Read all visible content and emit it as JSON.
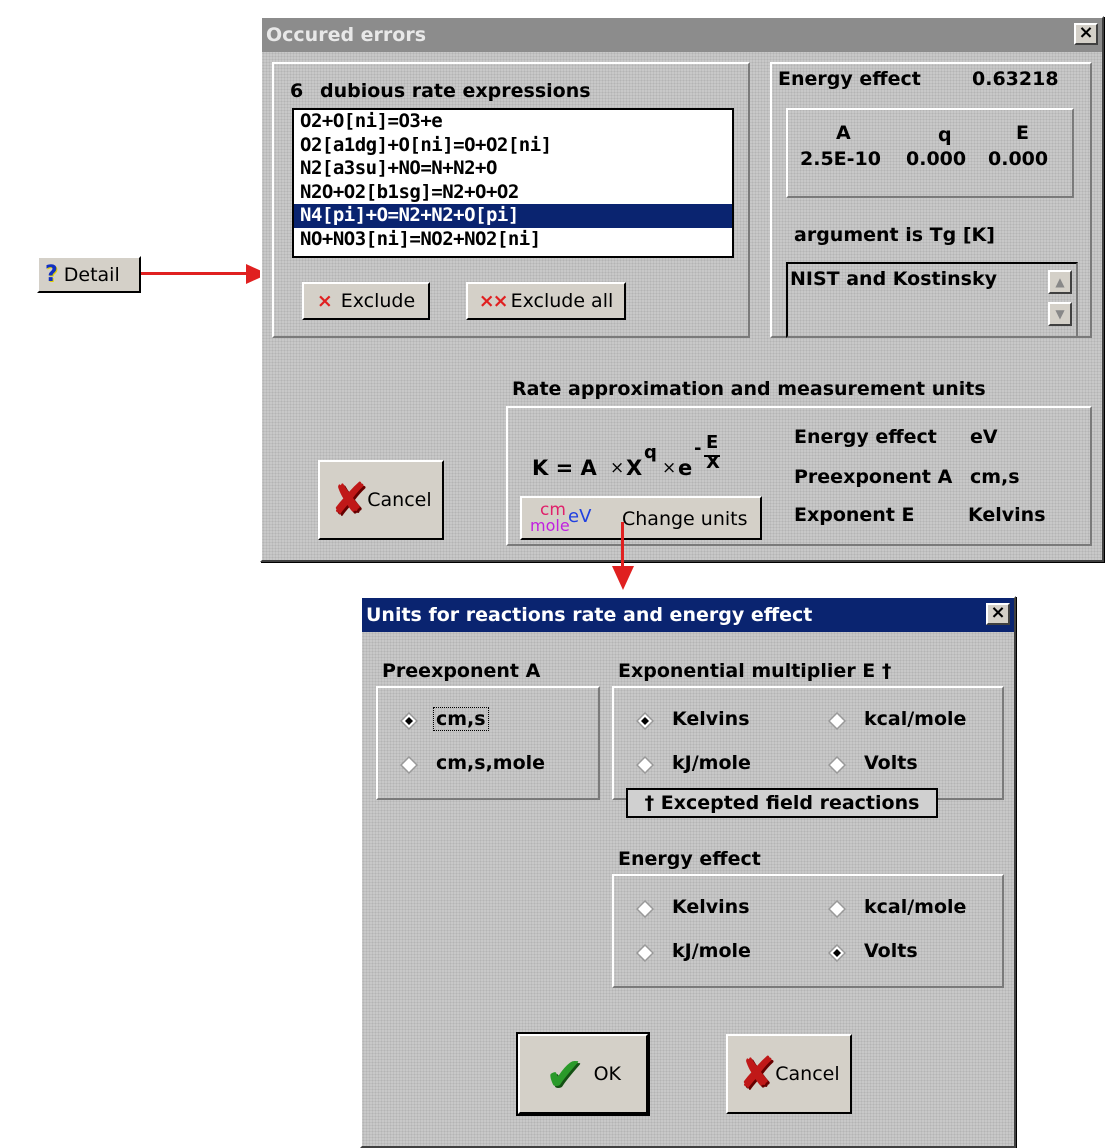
{
  "detail_button": {
    "label": "Detail",
    "icon": "help-question-icon"
  },
  "errors_window": {
    "title": "Occured errors",
    "count": "6",
    "count_label": "dubious rate expressions",
    "reactions": [
      "O2+O[ni]=O3+e",
      "O2[a1dg]+O[ni]=O+O2[ni]",
      "N2[a3su]+NO=N+N2+O",
      "N2O+O2[b1sg]=N2+O+O2",
      "N4[pi]+O=N2+N2+O[pi]",
      "NO+NO3[ni]=NO2+NO2[ni]"
    ],
    "selected_index": 4,
    "exclude_label": "Exclude",
    "exclude_all_label": "Exclude all",
    "energy_effect_label": "Energy effect",
    "energy_effect_value": "0.63218",
    "params_headers": [
      "A",
      "q",
      "E"
    ],
    "params_values": [
      "2.5E-10",
      "0.000",
      "0.000"
    ],
    "argument_label": "argument is Tg [K]",
    "source_text": "NIST and Kostinsky",
    "rate_section_title": "Rate approximation and measurement units",
    "formula_lhs": "K = A",
    "formula_times": "×",
    "formula_x": "X",
    "formula_q": "q",
    "formula_e": "e",
    "formula_E": "E",
    "formula_minus": "-",
    "change_units_label": "Change units",
    "change_units_icon": {
      "cm": "cm",
      "mole": "mole",
      "ev": "eV"
    },
    "units": [
      {
        "label": "Energy effect",
        "value": "eV"
      },
      {
        "label": "Preexponent A",
        "value": "cm,s"
      },
      {
        "label": "Exponent E",
        "value": "Kelvins"
      }
    ],
    "cancel_label": "Cancel"
  },
  "units_dialog": {
    "title": "Units for reactions rate and energy effect",
    "preexponent_title": "Preexponent A",
    "preexponent_options": [
      "cm,s",
      "cm,s,mole"
    ],
    "preexponent_selected": 0,
    "exponential_title": "Exponential multiplier E †",
    "exponential_options": [
      "Kelvins",
      "kcal/mole",
      "kJ/mole",
      "Volts"
    ],
    "exponential_selected": 0,
    "excepted_label": "† Excepted field reactions",
    "energy_title": "Energy effect",
    "energy_options": [
      "Kelvins",
      "kcal/mole",
      "kJ/mole",
      "Volts"
    ],
    "energy_selected": 3,
    "ok_label": "OK",
    "cancel_label": "Cancel"
  },
  "colors": {
    "selection": "#0a2470",
    "arrow": "#e02020",
    "cm_icon": "#e0206a",
    "mole_icon": "#c020e0",
    "ev_icon": "#2040e0",
    "ok_check": "#2a9a2a",
    "cancel_x": "#c01818"
  }
}
